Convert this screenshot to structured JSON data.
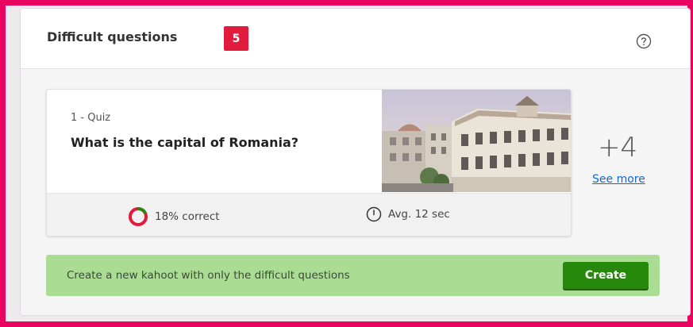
{
  "header": {
    "title": "Difficult questions",
    "count": "5",
    "help_icon": "question-circle-icon"
  },
  "question": {
    "kind": "1 - Quiz",
    "text": "What is the capital of Romania?",
    "image": "city-buildings-photo",
    "correct_label": "18% correct",
    "correct_fraction": 0.18,
    "time_label": "Avg. 12 sec"
  },
  "more": {
    "count": "+4",
    "link": "See more"
  },
  "create": {
    "text": "Create a new kahoot with only the difficult questions",
    "button": "Create"
  },
  "colors": {
    "outer_border": "#e8045f",
    "badge": "#e21b3c",
    "correct": "#26890c",
    "incorrect": "#e21b3c",
    "create_bar": "#abdc94",
    "create_button": "#26890c",
    "link": "#1368ce"
  }
}
